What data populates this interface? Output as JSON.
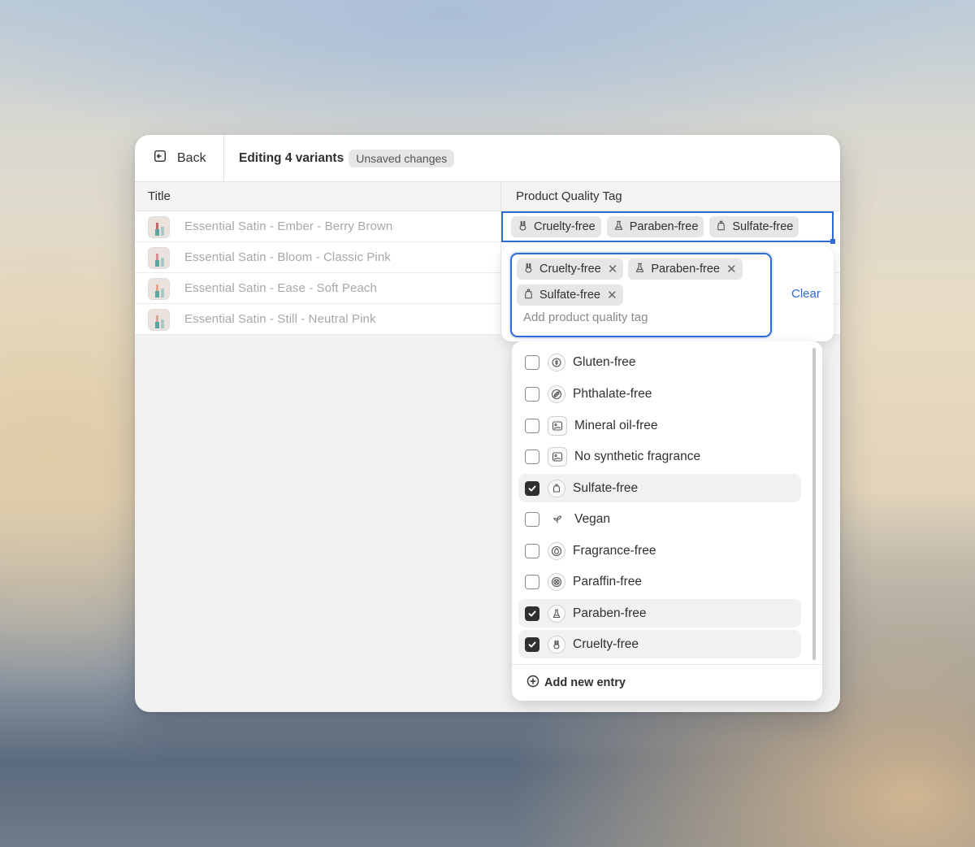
{
  "topbar": {
    "back_label": "Back",
    "editing_label": "Editing 4 variants",
    "unsaved_badge": "Unsaved changes"
  },
  "table": {
    "columns": [
      "Title",
      "Product Quality Tag"
    ],
    "rows": [
      "Essential Satin - Ember - Berry Brown",
      "Essential Satin - Bloom - Classic Pink",
      "Essential Satin - Ease - Soft Peach",
      "Essential Satin - Still - Neutral Pink"
    ],
    "active_cell_tags": [
      "Cruelty-free",
      "Paraben-free",
      "Sulfate-free"
    ]
  },
  "editor": {
    "selected_tags": [
      "Cruelty-free",
      "Paraben-free",
      "Sulfate-free"
    ],
    "placeholder": "Add product quality tag",
    "clear_label": "Clear"
  },
  "dropdown": {
    "options": [
      {
        "label": "Gluten-free",
        "checked": false,
        "icon": "gluten-icon"
      },
      {
        "label": "Phthalate-free",
        "checked": false,
        "icon": "no-pill-icon"
      },
      {
        "label": "Mineral oil-free",
        "checked": false,
        "icon": "image-placeholder-icon"
      },
      {
        "label": "No synthetic fragrance",
        "checked": false,
        "icon": "image-placeholder-icon"
      },
      {
        "label": "Sulfate-free",
        "checked": true,
        "icon": "bottle-icon"
      },
      {
        "label": "Vegan",
        "checked": false,
        "icon": "leaf-icon"
      },
      {
        "label": "Fragrance-free",
        "checked": false,
        "icon": "drop-icon"
      },
      {
        "label": "Paraffin-free",
        "checked": false,
        "icon": "cross-circle-icon"
      },
      {
        "label": "Paraben-free",
        "checked": true,
        "icon": "flask-icon"
      },
      {
        "label": "Cruelty-free",
        "checked": true,
        "icon": "rabbit-icon"
      }
    ],
    "add_entry_label": "Add new entry"
  },
  "colors": {
    "accent": "#2e6bd6",
    "chip_bg": "#e6e6e6",
    "checked_bg": "#303030"
  }
}
